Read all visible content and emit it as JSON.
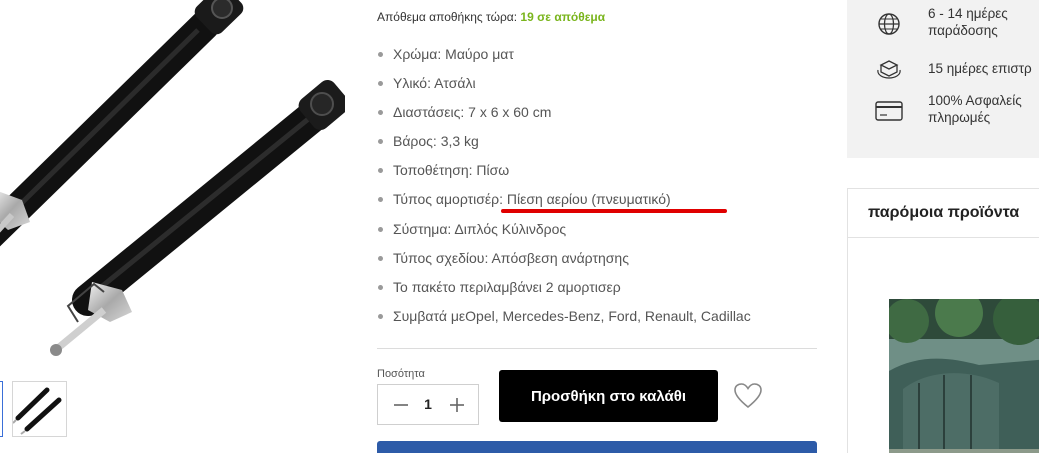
{
  "stock": {
    "label": "Απόθεμα αποθήκης τώρα:",
    "value": "19 σε απόθεμα",
    "value_color": "#7ab51d"
  },
  "specs": [
    "Χρώμα: Μαύρο ματ",
    "Υλικό: Ατσάλι",
    "Διαστάσεις: 7 x 6 x 60 cm",
    "Βάρος: 3,3 kg",
    "Τοποθέτηση: Πίσω",
    "Τύπος αμορτισέρ: Πίεση αερίου (πνευματικό)",
    "Σύστημα: Διπλός Κύλινδρος",
    "Τύπος σχεδίου: Απόσβεση ανάρτησης",
    "Το πακέτο περιλαμβάνει 2 αμορτισερ",
    "Συμβατά μεOpel, Mercedes-Benz, Ford, Renault, Cadillac"
  ],
  "quantity": {
    "label": "Ποσότητα",
    "value": "1",
    "minus_icon": "minus-icon",
    "plus_icon": "plus-icon"
  },
  "cart": {
    "add_label": "Προσθήκη στο καλάθι",
    "button_color": "#000000"
  },
  "wishlist_icon": "heart-icon",
  "annotation_color": "#e00000",
  "accent_blue": "#2d5ba8",
  "info_panel": [
    {
      "icon": "globe-icon",
      "text_line1": "6 - 14 ημέρες",
      "text_line2": "παράδοσης"
    },
    {
      "icon": "return-box-icon",
      "text_line1": "15 ημέρες επιστρ",
      "text_line2": ""
    },
    {
      "icon": "credit-card-icon",
      "text_line1": "100% Ασφαλείς",
      "text_line2": "πληρωμές"
    }
  ],
  "similar": {
    "title": "παρόμοια προϊόντα"
  }
}
